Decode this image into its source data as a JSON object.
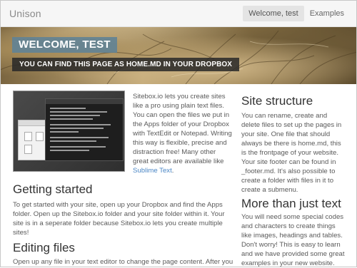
{
  "navbar": {
    "brand": "Unison",
    "items": [
      {
        "label": "Welcome, test",
        "active": true
      },
      {
        "label": "Examples",
        "active": false
      }
    ]
  },
  "hero": {
    "title": "WELCOME, TEST",
    "subtitle": "YOU CAN FIND THIS PAGE AS HOME.MD IN YOUR DROPBOX"
  },
  "intro": {
    "text": "Sitebox.io lets you create sites like a pro using plain text files. You can open the files we put in the Apps folder of your Dropbox with TextEdit or Notepad. Writing this way is flexible, precise and distraction free! Many other great editors are available like ",
    "link": "Sublime Text",
    "end": "."
  },
  "getting_started": {
    "heading": "Getting started",
    "text": "To get started with your site, open up your Dropbox and find the Apps folder. Open up the Sitebox.io folder and your site folder within it. Your site is in a seperate folder because Sitebox.io lets you create multiple sites!"
  },
  "editing_files": {
    "heading": "Editing files",
    "text": "Open up any file in your text editor to change the page content. After you"
  },
  "site_structure": {
    "heading": "Site structure",
    "text": "You can rename, create and delete files to set up the pages in your site. One file that should always be there is home.md, this is the frontpage of your website. Your site footer can be found in _footer.md. It's also possible to create a folder with files in it to create a submenu."
  },
  "more_text": {
    "heading": "More than just text",
    "text": "You will need some special codes and characters to create things like images, headings and tables. Don't worry! This is easy to learn and we have provided some great examples in your new website."
  },
  "colors": {
    "link": "#4a86c5",
    "welcome_bg": "#5f8296",
    "subtitle_bg": "#282828"
  }
}
